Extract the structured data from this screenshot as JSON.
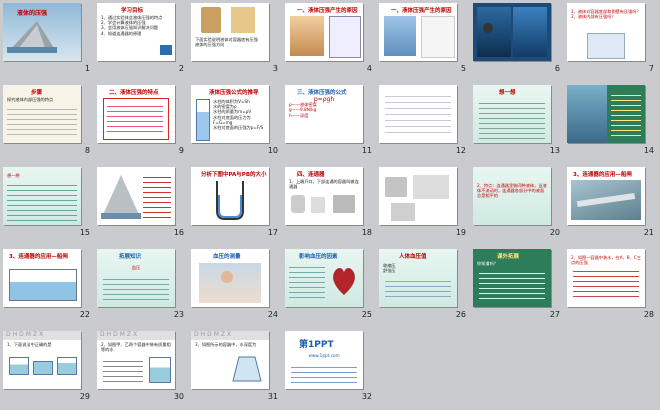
{
  "slides": [
    {
      "n": "1",
      "title": "液体的压强"
    },
    {
      "n": "2",
      "title": "学习目标",
      "lines": [
        "1、通过实验体会液体压强的特点",
        "2、学会计算液体的压强",
        "3、会用液体压强知识解决问题",
        "4、知道连通器的原理"
      ]
    },
    {
      "n": "3",
      "title": "",
      "lines": [
        "下面实验说明液体对容器底有压强",
        "液体的压强方向"
      ]
    },
    {
      "n": "4",
      "title": "一、液体压强产生的原因"
    },
    {
      "n": "5",
      "title": "一、液体压强产生的原因"
    },
    {
      "n": "6",
      "title": ""
    },
    {
      "n": "7",
      "title": "",
      "lines": [
        "1、液体对容器底部和侧壁有压强吗？",
        "2、液体内部有压强吗？"
      ]
    },
    {
      "n": "8",
      "title": "步骤",
      "lines": [
        "探究液体内部压强的特点"
      ]
    },
    {
      "n": "9",
      "title": "二、液体压强的特点"
    },
    {
      "n": "10",
      "title": "液体压强公式的推导",
      "lines": [
        "水柱的体积为V=Sh",
        "水的密度为ρ",
        "水柱的质量为m=ρV",
        "水柱对底面的压力为F=G=mg",
        "水柱对底面的压强为p=F/S"
      ]
    },
    {
      "n": "11",
      "title": "三、液体压强的公式",
      "lines": [
        "p=ρgh",
        "ρ——液体密度",
        "g——9.8N/kg",
        "h——深度"
      ]
    },
    {
      "n": "12",
      "title": ""
    },
    {
      "n": "13",
      "title": "想一想"
    },
    {
      "n": "14",
      "title": ""
    },
    {
      "n": "15",
      "title": "",
      "lines": [
        "想一想"
      ]
    },
    {
      "n": "16",
      "title": ""
    },
    {
      "n": "17",
      "title": "分析下图中PA与PB的大小"
    },
    {
      "n": "18",
      "title": "四、连通器",
      "lines": [
        "1、上端开口，下部连通的容器叫做连通器"
      ]
    },
    {
      "n": "19",
      "title": ""
    },
    {
      "n": "20",
      "title": "",
      "lines": [
        "2、特点：连通器里装同种液体，当液体不流动时，连通器各部分中的液面总是相平的"
      ]
    },
    {
      "n": "21",
      "title": "3、连通器的应用—船闸"
    },
    {
      "n": "22",
      "title": "3、连通器的应用—船闸"
    },
    {
      "n": "23",
      "title": "拓展知识",
      "lines": [
        "血压"
      ]
    },
    {
      "n": "24",
      "title": "血压的测量"
    },
    {
      "n": "25",
      "title": "影响血压的因素"
    },
    {
      "n": "26",
      "title": "人体血压值",
      "lines": [
        "收缩压",
        "舒张压"
      ]
    },
    {
      "n": "27",
      "title": "课外拓展",
      "lines": [
        "你知道吗？"
      ]
    },
    {
      "n": "28",
      "title": "",
      "lines": [
        "2、如图一容器中装水，在A、B、C三点的压强"
      ]
    },
    {
      "n": "29",
      "title": "",
      "lines": [
        "1、下面说法中正确的是"
      ]
    },
    {
      "n": "30",
      "title": "",
      "lines": [
        "2、如图甲、乙两个容器中装有质量相等的水"
      ]
    },
    {
      "n": "31",
      "title": "",
      "lines": [
        "3、如图所示的容器中，水深度为"
      ]
    },
    {
      "n": "32",
      "title": "第1PPT",
      "lines": [
        "www.1ppt.com"
      ]
    }
  ],
  "colors": {
    "accent": "#c00000",
    "bg": "#c9cbcf",
    "teal": "#2e7d5a",
    "blue": "#1f5fb0"
  }
}
